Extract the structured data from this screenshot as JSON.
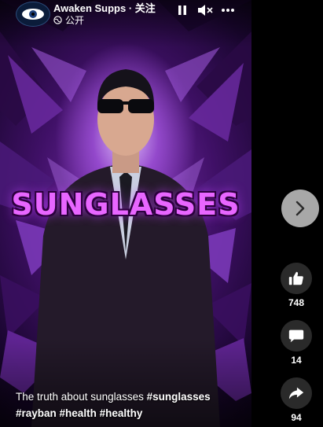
{
  "header": {
    "page_name": "Awaken Supps · 关注",
    "audience": "公开"
  },
  "video": {
    "overlay_title": "SUNGLASSES",
    "caption_text": "The truth about sunglasses",
    "caption_tags": [
      "#sunglasses",
      "#rayban",
      "#health",
      "#healthy"
    ]
  },
  "actions": {
    "likes": "748",
    "comments": "14",
    "shares": "94"
  },
  "icons": {
    "pause": "pause-icon",
    "mute": "volume-muted-icon",
    "more": "more-icon",
    "next": "chevron-right-icon",
    "like": "thumbs-up-icon",
    "comment": "comment-icon",
    "share": "share-icon",
    "audience": "globe-icon"
  }
}
